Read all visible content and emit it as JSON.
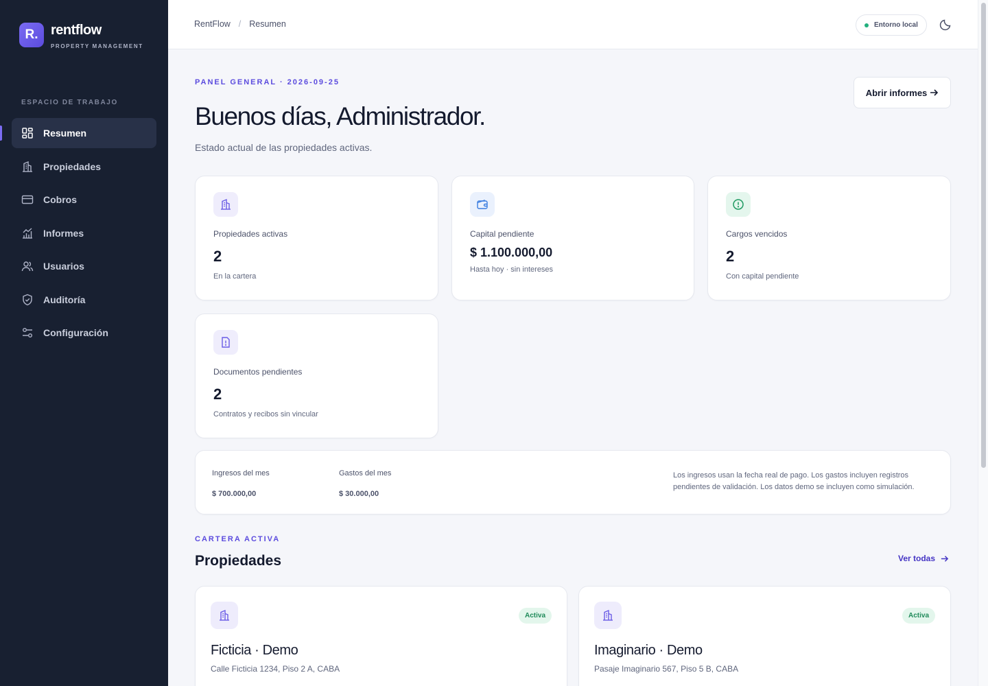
{
  "brand": {
    "logo_text": "R.",
    "name": "rentflow",
    "subtitle": "PROPERTY MANAGEMENT"
  },
  "sidebar": {
    "section_label": "ESPACIO DE TRABAJO",
    "items": [
      {
        "label": "Resumen",
        "icon": "dashboard-icon",
        "active": true
      },
      {
        "label": "Propiedades",
        "icon": "building-icon"
      },
      {
        "label": "Cobros",
        "icon": "credit-card-icon"
      },
      {
        "label": "Informes",
        "icon": "chart-icon"
      },
      {
        "label": "Usuarios",
        "icon": "users-icon"
      },
      {
        "label": "Auditoría",
        "icon": "shield-icon"
      },
      {
        "label": "Configuración",
        "icon": "sliders-icon"
      }
    ]
  },
  "topbar": {
    "breadcrumbs": [
      "RentFlow",
      "Resumen"
    ],
    "separator": "/",
    "env_badge": "Entorno local",
    "theme_icon": "moon-icon"
  },
  "hero": {
    "eyebrow": "PANEL GENERAL · 2026-09-25",
    "title": "Buenos días, Administrador.",
    "subtitle": "Estado actual de las propiedades activas.",
    "open_reports_label": "Abrir informes"
  },
  "stats": [
    {
      "label": "Propiedades activas",
      "value": "2",
      "note": "En la cartera",
      "icon": "building-icon"
    },
    {
      "label": "Capital pendiente",
      "value": "$ 1.100.000,00",
      "note": "Hasta hoy · sin intereses",
      "icon": "wallet-icon"
    },
    {
      "label": "Cargos vencidos",
      "value": "2",
      "note": "Con capital pendiente",
      "icon": "alert-circle-icon"
    },
    {
      "label": "Documentos pendientes",
      "value": "2",
      "note": "Contratos y recibos sin vincular",
      "icon": "file-alert-icon"
    }
  ],
  "finance": {
    "income_label": "Ingresos del mes",
    "income_value": "$ 700.000,00",
    "expenses_label": "Gastos del mes",
    "expenses_value": "$ 30.000,00",
    "note": "Los ingresos usan la fecha real de pago. Los gastos incluyen registros pendientes de validación. Los datos demo se incluyen como simulación."
  },
  "portfolio": {
    "eyebrow": "CARTERA ACTIVA",
    "title": "Propiedades",
    "view_all_label": "Ver todas",
    "properties": [
      {
        "name": "Ficticia · Demo",
        "address": "Calle Ficticia 1234, Piso 2 A, CABA",
        "status": "Activa"
      },
      {
        "name": "Imaginario · Demo",
        "address": "Pasaje Imaginario 567, Piso 5 B, CABA",
        "status": "Activa"
      }
    ]
  },
  "colors": {
    "accent": "#5b4bde",
    "sidebar_bg": "#182031",
    "success": "#22b07d"
  }
}
